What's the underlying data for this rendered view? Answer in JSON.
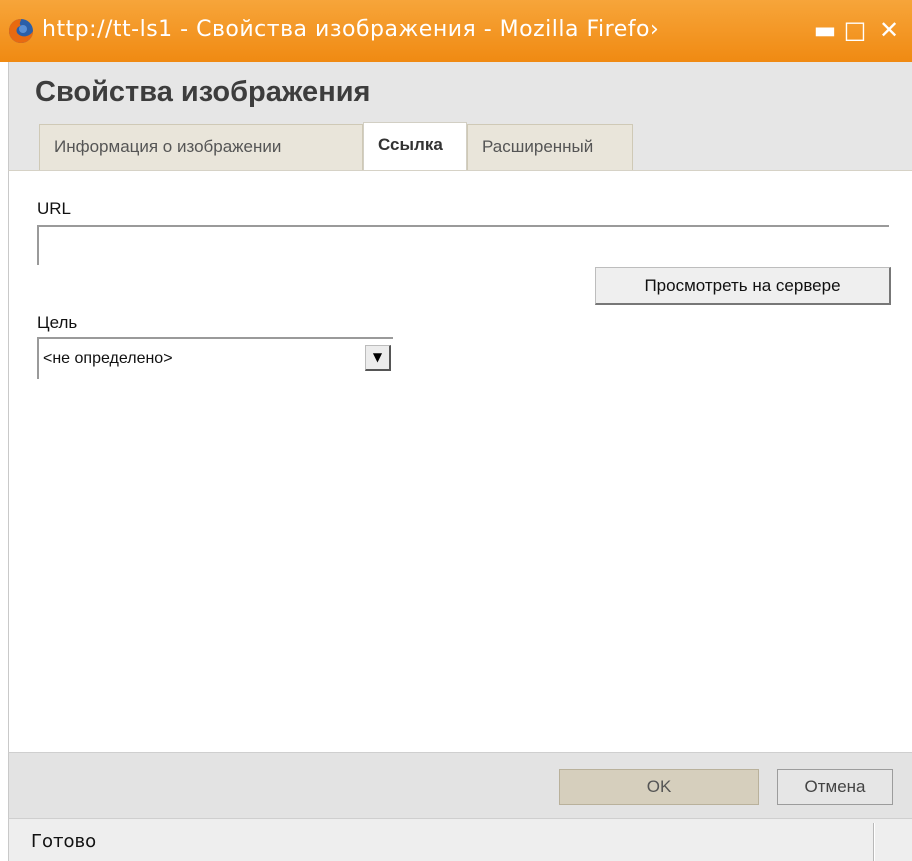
{
  "window": {
    "title": "http://tt-ls1 - Свойства изображения - Mozilla Firefo›",
    "icon": "firefox-icon",
    "controls": {
      "minimize": "▬",
      "maximize": "□",
      "close": "✕"
    },
    "accent": "#f0900f"
  },
  "dialog": {
    "title": "Свойства изображения",
    "tabs": [
      {
        "label": "Информация о изображении",
        "active": false
      },
      {
        "label": "Ссылка",
        "active": true
      },
      {
        "label": "Расширенный",
        "active": false
      }
    ],
    "link": {
      "url_label": "URL",
      "url_value": "",
      "browse_button": "Просмотреть на сервере",
      "target_label": "Цель",
      "target_selected": "<не определено>"
    },
    "buttons": {
      "ok": "OK",
      "cancel": "Отмена"
    }
  },
  "statusbar": {
    "text": "Готово"
  }
}
